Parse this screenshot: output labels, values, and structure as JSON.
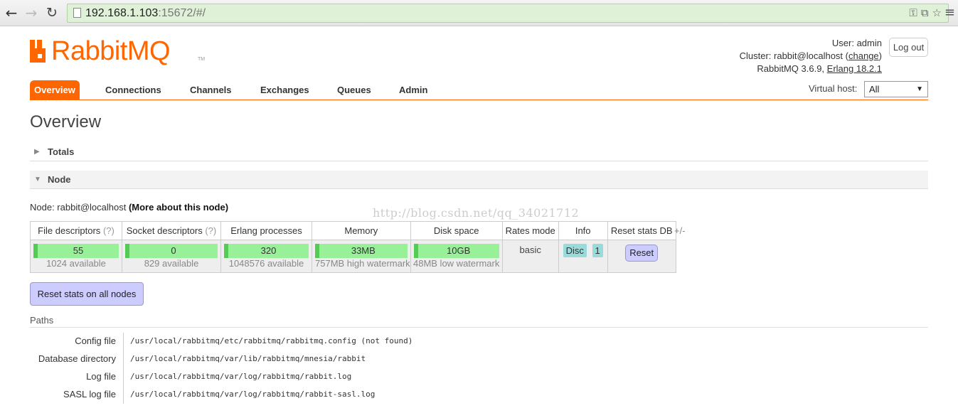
{
  "browser": {
    "url_host": "192.168.1.103",
    "url_rest": ":15672/#/"
  },
  "header": {
    "brand": "RabbitMQ",
    "user_label": "User:",
    "user": "admin",
    "cluster_label": "Cluster:",
    "cluster": "rabbit@localhost",
    "change_link": "change",
    "version": "RabbitMQ 3.6.9,",
    "erlang_link": "Erlang 18.2.1",
    "logout": "Log out"
  },
  "tabs": [
    {
      "label": "Overview",
      "active": true
    },
    {
      "label": "Connections"
    },
    {
      "label": "Channels"
    },
    {
      "label": "Exchanges"
    },
    {
      "label": "Queues"
    },
    {
      "label": "Admin"
    }
  ],
  "vhost": {
    "label": "Virtual host:",
    "selected": "All"
  },
  "page_title": "Overview",
  "sections": {
    "totals": "Totals",
    "node": "Node"
  },
  "node": {
    "prefix": "Node: rabbit@localhost",
    "more_link": "(More about this node)"
  },
  "watermark": "http://blog.csdn.net/qq_34021712",
  "stats_table": {
    "headers": {
      "file_desc": "File descriptors",
      "socket_desc": "Socket descriptors",
      "help": "(?)",
      "erlang": "Erlang processes",
      "memory": "Memory",
      "disk": "Disk space",
      "rates": "Rates mode",
      "info": "Info",
      "reset": "Reset stats DB"
    },
    "row": {
      "file_desc": {
        "value": "55",
        "sub": "1024 available"
      },
      "socket_desc": {
        "value": "0",
        "sub": "829 available"
      },
      "erlang": {
        "value": "320",
        "sub": "1048576 available"
      },
      "memory": {
        "value": "33MB",
        "sub": "757MB high watermark"
      },
      "disk": {
        "value": "10GB",
        "sub": "48MB low watermark"
      },
      "rates": "basic",
      "info_disc": "Disc",
      "info_count": "1",
      "reset_button": "Reset"
    },
    "plusminus": "+/-"
  },
  "reset_all_button": "Reset stats on all nodes",
  "paths": {
    "title": "Paths",
    "rows": [
      {
        "key": "Config file",
        "value": "/usr/local/rabbitmq/etc/rabbitmq/rabbitmq.config (not found)"
      },
      {
        "key": "Database directory",
        "value": "/usr/local/rabbitmq/var/lib/rabbitmq/mnesia/rabbit"
      },
      {
        "key": "Log file",
        "value": "/usr/local/rabbitmq/var/log/rabbitmq/rabbit.log"
      },
      {
        "key": "SASL log file",
        "value": "/usr/local/rabbitmq/var/log/rabbitmq/rabbit-sasl.log"
      }
    ]
  },
  "colors": {
    "brand_orange": "#ff6600",
    "bar_green": "#98f198",
    "button_lavender": "#ccccff",
    "badge_teal": "#99dbdb"
  }
}
